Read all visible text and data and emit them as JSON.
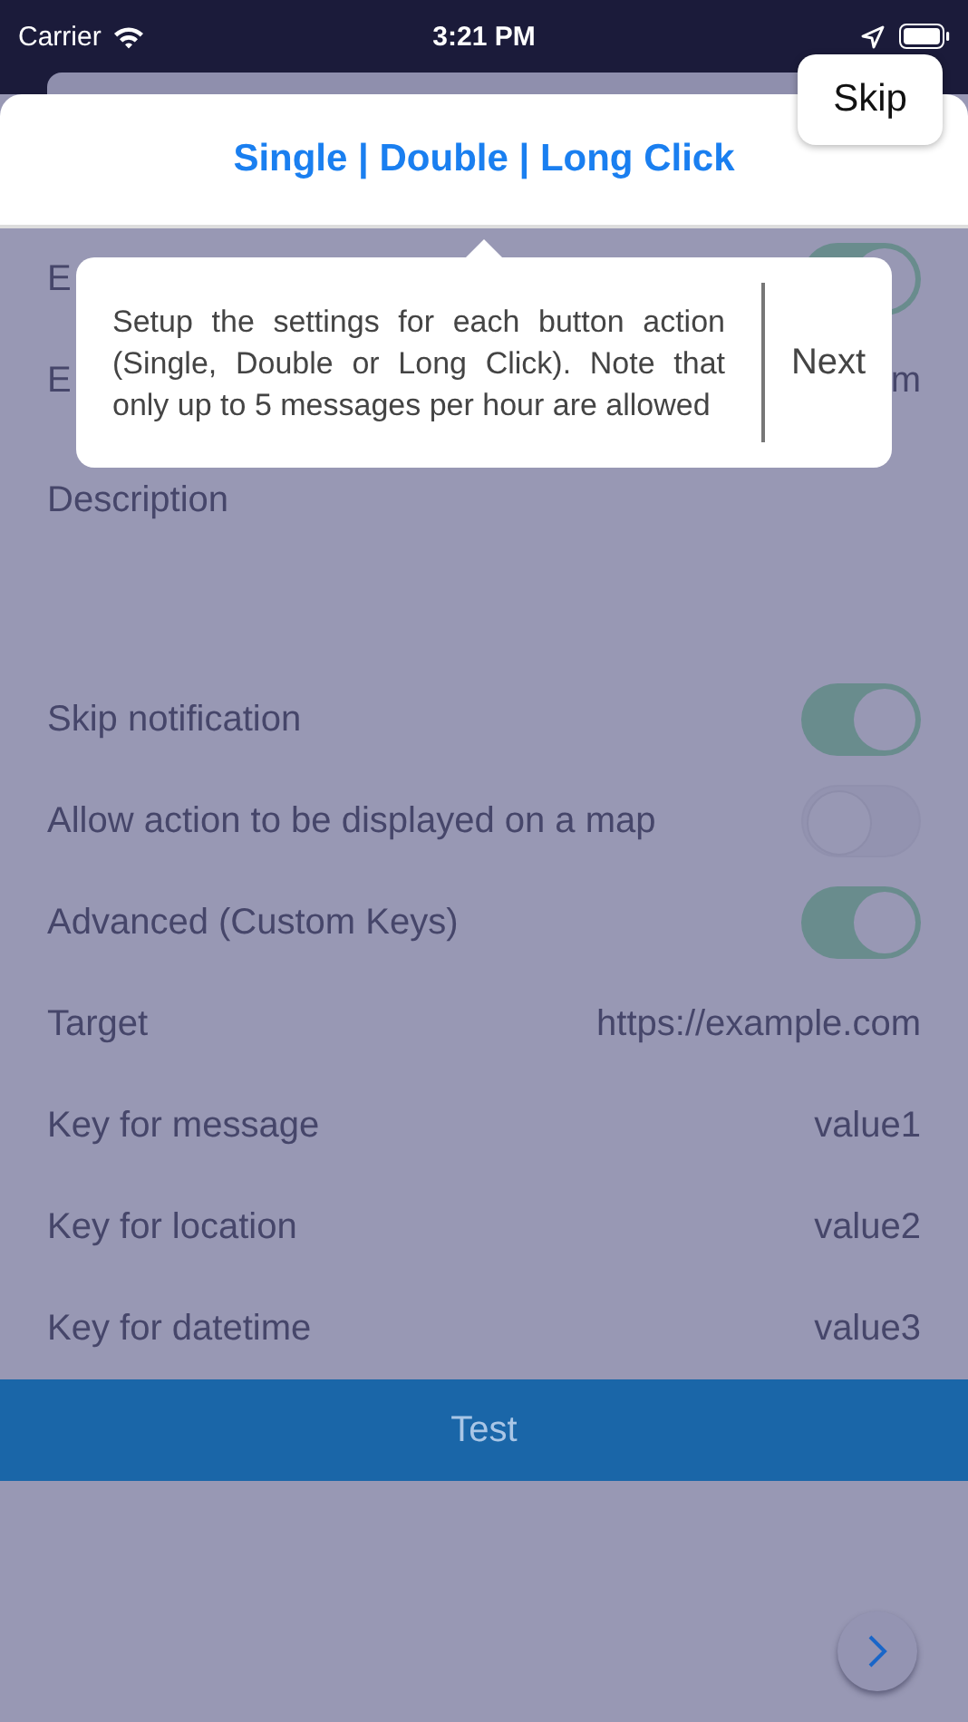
{
  "status_bar": {
    "carrier": "Carrier",
    "time": "3:21 PM"
  },
  "skip_button": "Skip",
  "header": {
    "title": "Single | Double | Long Click"
  },
  "rows": [
    {
      "kind": "toggle",
      "label": "E",
      "on": true
    },
    {
      "kind": "value",
      "label": "E",
      "value": "m"
    },
    {
      "kind": "text",
      "label": "Description"
    },
    {
      "kind": "spacer"
    },
    {
      "kind": "toggle",
      "label": "Skip notification",
      "on": true
    },
    {
      "kind": "toggle",
      "label": "Allow action to be displayed on a map",
      "on": false
    },
    {
      "kind": "toggle",
      "label": "Advanced (Custom Keys)",
      "on": true
    },
    {
      "kind": "value",
      "label": "Target",
      "value": "https://example.com"
    },
    {
      "kind": "value",
      "label": "Key for message",
      "value": "value1"
    },
    {
      "kind": "value",
      "label": "Key for location",
      "value": "value2"
    },
    {
      "kind": "value",
      "label": "Key for datetime",
      "value": "value3"
    }
  ],
  "test_button": "Test",
  "tooltip": {
    "text": "Setup the settings for each button action (Single, Double or Long Click). Note that only up to 5 messages per hour are allowed",
    "action": "Next"
  }
}
